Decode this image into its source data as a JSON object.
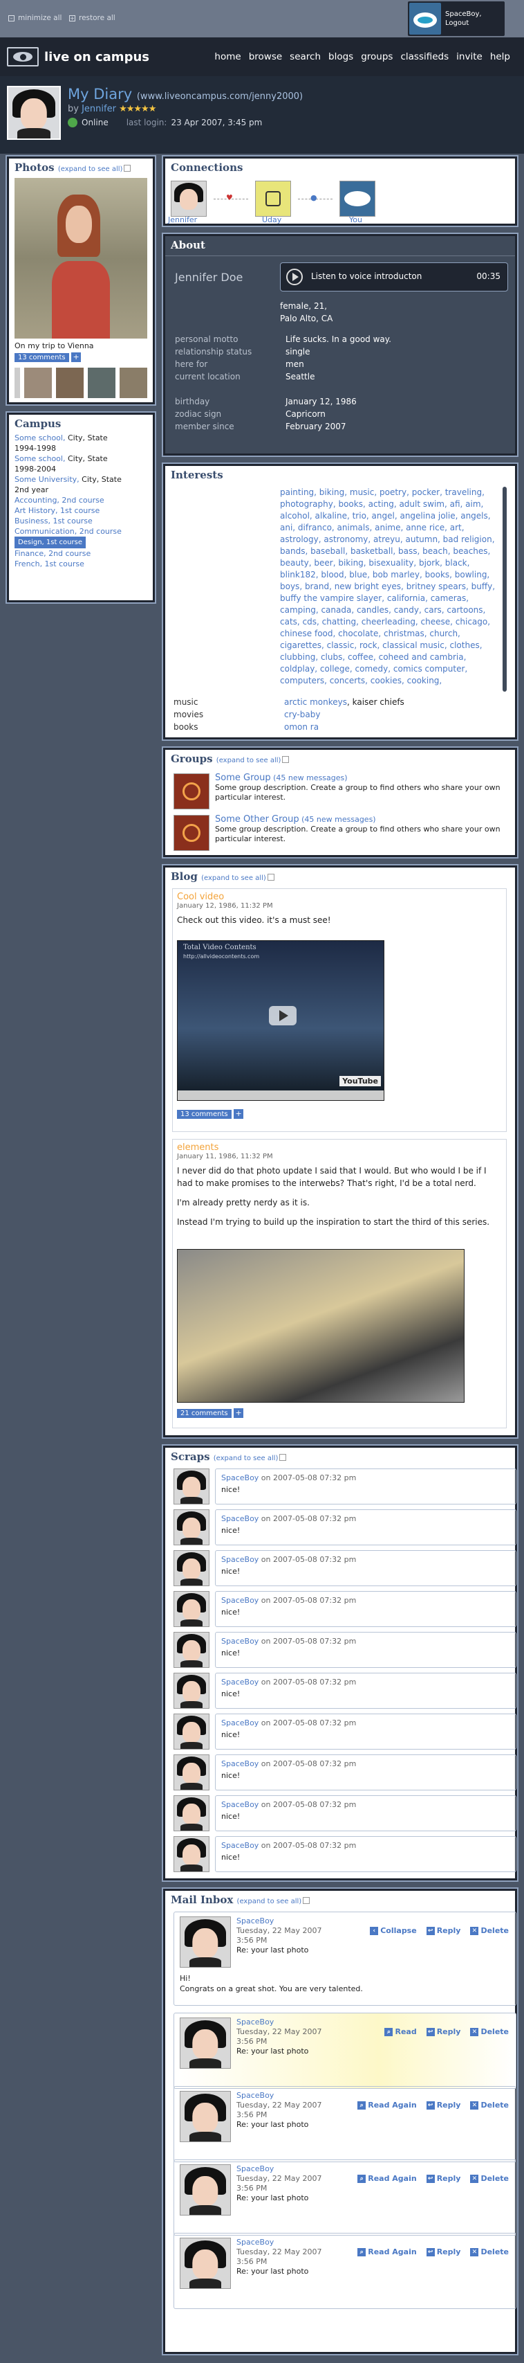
{
  "topbar": {
    "minimize_label": "minimize all",
    "restore_label": "restore all",
    "user_name": "SpaceBoy,",
    "logout_label": "Logout"
  },
  "nav": {
    "brand": "live on campus",
    "items": [
      "home",
      "browse",
      "search",
      "blogs",
      "groups",
      "classifieds",
      "invite",
      "help"
    ]
  },
  "header": {
    "title": "My Diary",
    "url": "(www.liveoncampus.com/jenny2000)",
    "by_label": "by",
    "author": "Jennifer",
    "stars": "★★★★★",
    "status": "Online",
    "last_login_label": "last login:",
    "last_login": "23 Apr 2007, 3:45 pm"
  },
  "photos": {
    "title": "Photos",
    "expand": "(expand to see all)",
    "caption": "On my trip to Vienna",
    "comments": "13 comments",
    "plus": "+"
  },
  "campus": {
    "title": "Campus",
    "entries": [
      {
        "school": "Some school,",
        "loc": " City, State",
        "years": "1994-1998"
      },
      {
        "school": "Some school,",
        "loc": " City, State",
        "years": "1998-2004"
      },
      {
        "school": "Some University,",
        "loc": " City, State",
        "years": "2nd year"
      }
    ],
    "courses": [
      "Accounting, 2nd course",
      "Art History, 1st course",
      "Business, 1st course",
      "Communication, 2nd course",
      "Design, 1st course",
      "Finance, 2nd course",
      "French, 1st course"
    ]
  },
  "connections": {
    "title": "Connections",
    "people": [
      "Jennifer",
      "Uday",
      "You"
    ]
  },
  "about": {
    "title": "About",
    "name": "Jennifer Doe",
    "voice_label": "Listen to voice introducton",
    "voice_time": "00:35",
    "bio1": "female, 21,",
    "bio2": "Palo Alto, CA",
    "fields": [
      {
        "k": "personal motto",
        "v": "Life sucks. In a good way."
      },
      {
        "k": "relationship status",
        "v": "single"
      },
      {
        "k": "here for",
        "v": "men"
      },
      {
        "k": "current location",
        "v": "Seattle"
      }
    ],
    "fields2": [
      {
        "k": "birthday",
        "v": "January 12, 1986"
      },
      {
        "k": "zodiac sign",
        "v": "Capricorn"
      },
      {
        "k": "member since",
        "v": "February 2007"
      }
    ]
  },
  "interests": {
    "title": "Interests",
    "general": "painting, biking, music, poetry, pocker, traveling, photography, books, acting, adult swim, afi, aim, alcohol, alkaline, trio, angel, angelina jolie, angels, ani, difranco, animals, anime, anne rice, art, astrology, astronomy, atreyu, autumn, bad religion, bands, baseball, basketball, bass, beach, beaches, beauty, beer, biking, bisexuality, bjork, black, blink182, blood, blue, bob marley, books, bowling, boys, brand, new bright eyes, britney spears, buffy, buffy the vampire slayer, california, cameras, camping, canada, candles, candy, cars, cartoons, cats, cds, chatting, cheerleading, cheese, chicago, chinese food, chocolate, christmas, church, cigarettes, classic, rock, classical music, clothes, clubbing, clubs, coffee, coheed and cambria, coldplay, college, comedy, comics computer, computers, concerts, cookies, cooking,",
    "rows": [
      {
        "k": "music",
        "v1": "arctic monkeys",
        "v2": ", kaiser chiefs"
      },
      {
        "k": "movies",
        "v1": "cry-baby",
        "v2": ""
      },
      {
        "k": "books",
        "v1": "omon ra",
        "v2": ""
      }
    ]
  },
  "groups": {
    "title": "Groups",
    "expand": "(expand to see all)",
    "items": [
      {
        "name": "Some Group",
        "new": "(45 new messages)",
        "desc": "Some group description. Create a group to find others who share your own particular interest."
      },
      {
        "name": "Some Other Group",
        "new": "(45 new messages)",
        "desc": "Some group description. Create a group to find others who share your own particular interest."
      }
    ]
  },
  "blog": {
    "title": "Blog",
    "expand": "(expand to see all)",
    "post1": {
      "title": "Cool video",
      "date": "January 12, 1986, 11:32 PM",
      "text": "Check out this video. it's a must see!",
      "video_title": "Total Video Contents",
      "video_url": "http://allvideocontents.com",
      "yt": "YouTube",
      "comments": "13 comments"
    },
    "post2": {
      "title": "elements",
      "date": "January 11, 1986, 11:32 PM",
      "p1": "I never did do that photo update I said that I would. But who would I be if I had to make promises to the interwebs? That's right, I'd be a total nerd.",
      "p2": "I'm already pretty nerdy as it is.",
      "p3": "Instead I'm trying to build up the inspiration to start the third of this series.",
      "comments": "21 comments"
    }
  },
  "scraps": {
    "title": "Scraps",
    "expand": "(expand to see all)",
    "author": "SpaceBoy",
    "meta": " on 2007-05-08 07:32 pm",
    "text": "nice!",
    "count": 10
  },
  "inbox": {
    "title": "Mail Inbox",
    "expand": "(expand to see all)",
    "from": "SpaceBoy",
    "date1": "Tuesday, 22 May 2007",
    "date2": "3:56 PM",
    "subject": "Re: your last photo",
    "first_body1": "Hi!",
    "first_body2": "Congrats on a great shot. You are very talented.",
    "collapse": "Collapse",
    "read": "Read",
    "read_again": "Read Again",
    "reply": "Reply",
    "delete": "Delete"
  },
  "colors": {
    "accent": "#4a78c4",
    "background": "#4a5566",
    "header_bg": "#1f2530",
    "highlight": "#fdf8c8"
  }
}
